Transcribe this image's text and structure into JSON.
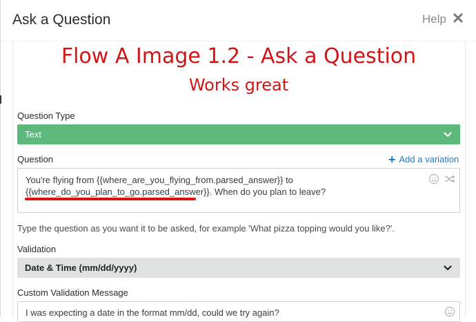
{
  "header": {
    "title": "Ask a Question",
    "help_label": "Help",
    "close_glyph": "✕"
  },
  "overlay": {
    "title": "Flow A Image 1.2 - Ask a Question",
    "subtitle": "Works great",
    "color": "#d01515"
  },
  "question_type": {
    "label": "Question Type",
    "selected": "Text",
    "color": "#5cb97b"
  },
  "question": {
    "label": "Question",
    "add_variation_label": "Add a variation",
    "line1": "You're flying from {{where_are_you_flying_from.parsed_answer}} to",
    "line2": "{{where_do_you_plan_to_go.parsed_answer}}. When do you plan to leave?",
    "helper": "Type the question as you want it to be asked, for example 'What pizza topping would you like?'."
  },
  "validation": {
    "label": "Validation",
    "selected": "Date & Time (mm/dd/yyyy)"
  },
  "custom_validation": {
    "label": "Custom Validation Message",
    "value": "I was expecting a date in the format mm/dd, could we try again?"
  },
  "icons": {
    "close": "close-icon",
    "chevron": "chevron-down-icon",
    "plus": "plus-icon",
    "emoji": "smile-icon",
    "shuffle": "shuffle-icon"
  }
}
